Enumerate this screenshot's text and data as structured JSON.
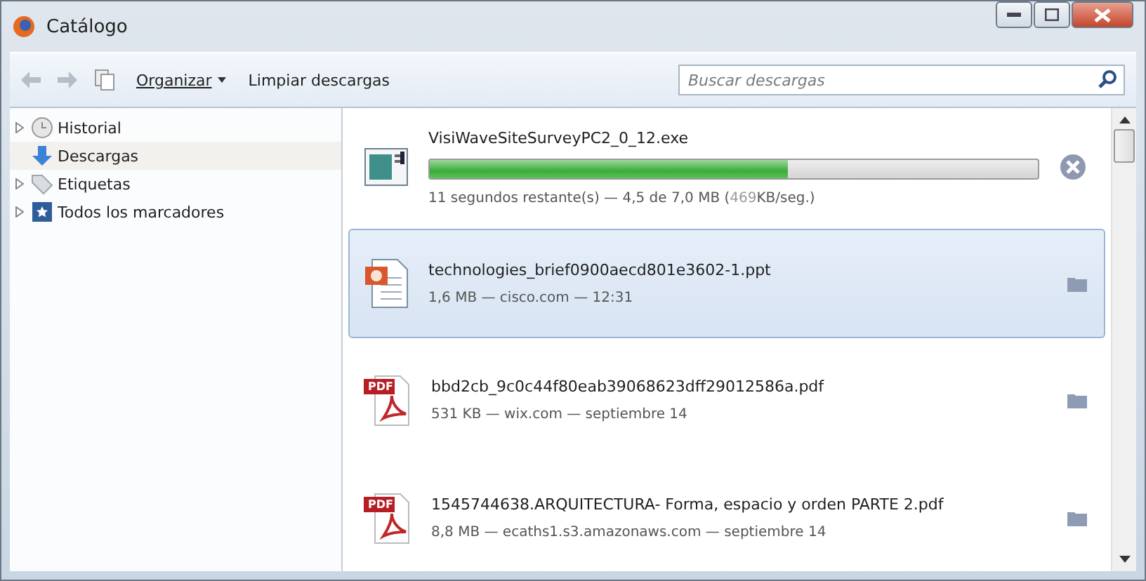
{
  "window": {
    "title": "Catálogo"
  },
  "toolbar": {
    "organize": "Organizar",
    "clear": "Limpiar descargas",
    "search": {
      "placeholder": "Buscar descargas"
    }
  },
  "sidebar": {
    "items": [
      {
        "label": "Historial",
        "kind": "history",
        "expandable": true,
        "selected": false
      },
      {
        "label": "Descargas",
        "kind": "downloads",
        "expandable": false,
        "selected": true
      },
      {
        "label": "Etiquetas",
        "kind": "tags",
        "expandable": true,
        "selected": false
      },
      {
        "label": "Todos los marcadores",
        "kind": "bookmarks",
        "expandable": true,
        "selected": false
      }
    ]
  },
  "downloads": [
    {
      "kind": "exe",
      "name": "VisiWaveSiteSurveyPC2_0_12.exe",
      "in_progress": true,
      "level": 0.59,
      "status": "11 segundos restante(s) — 4,5 de 7,0 MB (",
      "speed": "469",
      "status_end": "KB/seg.)",
      "selected": false
    },
    {
      "kind": "ppt",
      "name": "technologies_brief0900aecd801e3602-1.ppt",
      "in_progress": false,
      "status": "1,6 MB — cisco.com — 12:31",
      "selected": true
    },
    {
      "kind": "pdf",
      "icon_label": "PDF",
      "name": "bbd2cb_9c0c44f80eab39068623dff29012586a.pdf",
      "in_progress": false,
      "status": "531 KB — wix.com — septiembre 14",
      "selected": false
    },
    {
      "kind": "pdf",
      "icon_label": "PDF",
      "name": "1545744638.ARQUITECTURA- Forma, espacio y orden PARTE 2.pdf",
      "in_progress": false,
      "status": "8,8 MB — ecaths1.s3.amazonaws.com — septiembre 14",
      "selected": false
    }
  ]
}
